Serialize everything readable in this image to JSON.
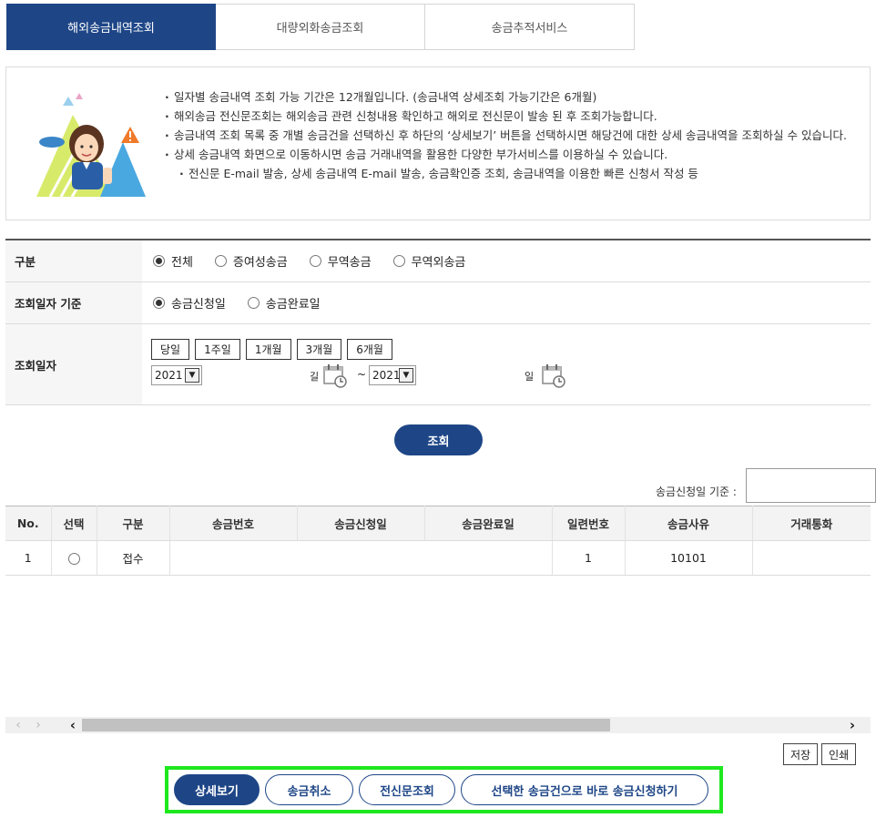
{
  "tabs": [
    {
      "label": "해외송금내역조회",
      "active": true
    },
    {
      "label": "대량외화송금조회",
      "active": false
    },
    {
      "label": "송금추적서비스",
      "active": false
    }
  ],
  "info": {
    "items": [
      "일자별 송금내역 조회 가능 기간은 12개월입니다. (송금내역 상세조회 가능기간은 6개월)",
      "해외송금 전신문조회는 해외송금 관련 신청내용 확인하고 해외로 전신문이 발송 된 후 조회가능합니다.",
      "송금내역 조회 목록 중 개별 송금건을 선택하신 후 하단의 ‘상세보기’ 버튼을 선택하시면 해당건에 대한 상세 송금내역을 조회하실 수 있습니다.",
      "상세 송금내역 화면으로 이동하시면 송금 거래내역을 활용한 다양한 부가서비스를 이용하실 수 있습니다."
    ],
    "sub_item": "전신문 E-mail 발송, 상세 송금내역 E-mail 발송, 송금확인증 조회, 송금내역을 이용한 빠른 신청서 작성 등"
  },
  "form": {
    "type_label": "구분",
    "type_options": [
      "전체",
      "증여성송금",
      "무역송금",
      "무역외송금"
    ],
    "type_selected": "전체",
    "basis_label": "조회일자 기준",
    "basis_options": [
      "송금신청일",
      "송금완료일"
    ],
    "basis_selected": "송금신청일",
    "date_label": "조회일자",
    "period_buttons": [
      "당일",
      "1주일",
      "1개월",
      "3개월",
      "6개월"
    ],
    "start_year": "2021",
    "end_year": "2021",
    "start_day_suffix": "길",
    "separator": "~",
    "end_day_suffix": "일"
  },
  "search_button": "조회",
  "sort_label": "송금신청일 기준 :",
  "table": {
    "headers": [
      "No.",
      "선택",
      "구분",
      "송금번호",
      "송금신청일",
      "송금완료일",
      "일련번호",
      "송금사유",
      "거래통화"
    ],
    "rows": [
      {
        "no": "1",
        "type": "접수",
        "remit_no": "",
        "apply_date": "",
        "done_date": "",
        "serial": "1",
        "reason": "10101",
        "currency": ""
      }
    ]
  },
  "scrollbar": {
    "prev": "‹",
    "next": "›",
    "left_arrow": "‹",
    "right_arrow": "›"
  },
  "small_buttons": {
    "save": "저장",
    "print": "인쇄"
  },
  "actions": [
    "상세보기",
    "송금취소",
    "전신문조회",
    "선택한 송금건으로 바로 송금신청하기"
  ],
  "colors": {
    "primary": "#1e4687",
    "highlight": "#1ee81e"
  }
}
